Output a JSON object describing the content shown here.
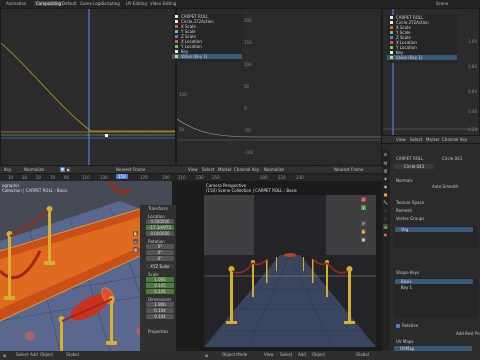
{
  "topbar": {
    "menus": [
      "Animation",
      "Compositing",
      "Default",
      "Game Logic",
      "Scripting",
      "UV Editing",
      "Video Editing"
    ],
    "active_index": 1,
    "scene_label": "Scene"
  },
  "graph_left": {
    "channels": [
      {
        "label": "CARPET ROLL",
        "color": "#e8e8e8"
      },
      {
        "label": "Circle.372Action",
        "color": "#e8e8e8"
      },
      {
        "label": "X Scale",
        "color": "#e85050"
      },
      {
        "label": "Y Scale",
        "color": "#60d060"
      },
      {
        "label": "Z Scale",
        "color": "#5080e8"
      },
      {
        "label": "X Location",
        "color": "#e85050"
      },
      {
        "label": "Y Location",
        "color": "#60d060"
      },
      {
        "label": "Key",
        "color": "#e8e8e8"
      },
      {
        "label": "Value (Key 1)",
        "color": "#e8c850"
      }
    ],
    "yticks": [
      "200",
      "150",
      "100",
      "50",
      "0",
      "-50",
      "-100"
    ]
  },
  "graph_right": {
    "channels": [
      {
        "label": "CARPET ROLL",
        "color": "#e8e8e8"
      },
      {
        "label": "Circle.372Action",
        "color": "#e8e8e8"
      },
      {
        "label": "X Scale",
        "color": "#e85050"
      },
      {
        "label": "Y Scale",
        "color": "#60d060"
      },
      {
        "label": "Z Scale",
        "color": "#5080e8"
      },
      {
        "label": "X Location",
        "color": "#e85050"
      },
      {
        "label": "Y Location",
        "color": "#60d060"
      },
      {
        "label": "Key",
        "color": "#e8e8e8"
      },
      {
        "label": "Value (Key 1)",
        "color": "#e8c850"
      }
    ],
    "yticks": [
      "1.00",
      "0.80",
      "0.60",
      "0.40",
      "0.20"
    ]
  },
  "graph_mid": {
    "yticks": [
      "200",
      "150",
      "100",
      "50",
      "0"
    ]
  },
  "timeline_header": {
    "left": [
      "Key",
      "Normalize"
    ],
    "right": [
      "View",
      "Select",
      "Marker",
      "Channel",
      "Key",
      "Normalize"
    ],
    "nearest_frame": "Nearest Frame"
  },
  "ruler": {
    "frames": [
      "10",
      "30",
      "50",
      "70",
      "90",
      "110",
      "130",
      "150",
      "170",
      "190",
      "210",
      "230",
      "250"
    ],
    "current_frame": "150",
    "right_frames": [
      "200",
      "220",
      "240",
      "2"
    ]
  },
  "viewport_left": {
    "title": "ographic",
    "subtitle": "Collection | CARPET ROLL : Basis"
  },
  "transform_panel": {
    "title": "Transform",
    "location_label": "Location",
    "location": [
      "4.000000",
      "-17.1m973",
      "0.000000"
    ],
    "rotation_label": "Rotation",
    "rotation": [
      "0°",
      "0°",
      "0°"
    ],
    "mode": "XYZ Euler",
    "scale_label": "Scale",
    "scale": [
      "1.000",
      "0.145",
      "0.145"
    ],
    "dimensions_label": "Dimensions",
    "dimensions": [
      "1.900",
      "0.104",
      "0.104"
    ],
    "properties": "Properties"
  },
  "viewport_right": {
    "title": "Camera Perspective",
    "subtitle": "(150) Scene Collection | CARPET ROLL : Basis"
  },
  "properties_panel": {
    "header": [
      "View",
      "Select",
      "Marker",
      "Channel",
      "Key"
    ],
    "object": "CARPET ROLL",
    "mesh": "Circle.043",
    "sub": "Circle.043",
    "sections": [
      "Normals",
      "Auto Smooth",
      "Texture Space",
      "Remesh",
      "Vertex Groups"
    ],
    "vertex_group": "Veg",
    "shape_keys_label": "Shape Keys",
    "shape_keys": [
      "Basis",
      "Key 1"
    ],
    "relative_label": "Relative",
    "add_rest": "Add Rest Po",
    "uv_maps_label": "UV Maps",
    "uvmap": "UVMap"
  },
  "bottom_left": {
    "items": [
      "Select",
      "Add",
      "Object",
      "Global"
    ]
  },
  "bottom_right": {
    "items": [
      "Object Mode",
      "View",
      "Select",
      "Add",
      "Object",
      "Global"
    ]
  },
  "colors": {
    "selection_orange": "#f0a030",
    "carpet_red": "#c83020",
    "pole_gold": "#d4b030",
    "floor_blue": "#5a6890",
    "timeline_blue": "#4f7fd6"
  }
}
